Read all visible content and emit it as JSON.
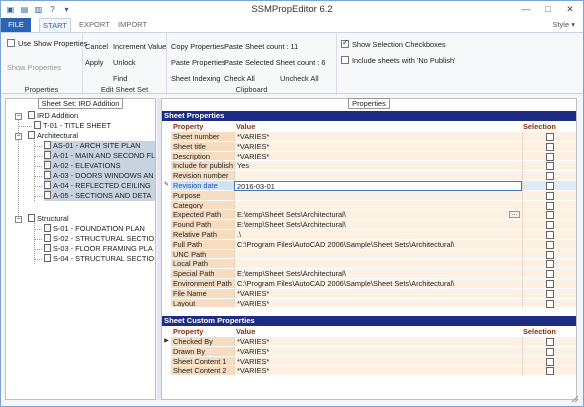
{
  "window": {
    "title": "SSMPropEditor 6.2"
  },
  "quick_access": [
    "save-icon",
    "folder-icon",
    "disk-icon",
    "help-icon",
    "dropdown-icon"
  ],
  "window_controls": {
    "minimize": "—",
    "maximize": "□",
    "close": "✕"
  },
  "tabs": [
    {
      "label": "FILE"
    },
    {
      "label": "START"
    },
    {
      "label": "EXPORT"
    },
    {
      "label": "IMPORT"
    }
  ],
  "style_label": "Style ▾",
  "ribbon": {
    "properties": {
      "use_show_properties": "Use Show Properties",
      "show_properties": "Show Properties",
      "group_label": "Properties"
    },
    "edit_sheet_set": {
      "cancel": "Cancel",
      "increment_value": "Increment Value",
      "apply": "Apply",
      "unlock": "Unlock",
      "find": "Find",
      "group_label": "Edit Sheet Set"
    },
    "clipboard": {
      "copy_properties": "Copy Properties",
      "sheet_count": "Paste Sheet count : 11",
      "paste_properties": "Paste Properties",
      "selected_sheet_count": "Paste Selected Sheet count : 6",
      "sheet_indexing": "Sheet Indexing",
      "check_all": "Check All",
      "uncheck_all": "Uncheck All",
      "group_label": "Clipboard"
    },
    "options": {
      "show_selection_checkboxes": "Show Selection Checkboxes",
      "include_no_publish": "Include sheets with 'No Publish'"
    }
  },
  "left_panel": {
    "title": "Sheet Set: IRD Addition",
    "root": "IRD Addition",
    "nodes": [
      {
        "label": "T-01 - TITLE SHEET"
      },
      {
        "label": "Architectural"
      },
      {
        "label": "AS-01 - ARCH SITE PLAN"
      },
      {
        "label": "A-01 - MAIN AND SECOND FL"
      },
      {
        "label": "A-02 - ELEVATIONS"
      },
      {
        "label": "A-03 - DOORS WINDOWS AN"
      },
      {
        "label": "A-04 - REFLECTED CEILING"
      },
      {
        "label": "A-05 - SECTIONS AND DETA"
      },
      {
        "label": "Structural"
      },
      {
        "label": "S-01 - FOUNDATION PLAN"
      },
      {
        "label": "S-02 - STRUCTURAL SECTIO"
      },
      {
        "label": "S-03 - FLOOR FRAMING PLA"
      },
      {
        "label": "S-04 - STRUCTURAL SECTIO"
      }
    ]
  },
  "right_panel": {
    "title": "Properties",
    "sheet_properties": {
      "header": "Sheet Properties",
      "columns": {
        "property": "Property",
        "value": "Value",
        "selection": "Selection"
      },
      "rows": [
        {
          "property": "Sheet number",
          "value": "*VARIES*"
        },
        {
          "property": "Sheet title",
          "value": "*VARIES*"
        },
        {
          "property": "Description",
          "value": "*VARIES*"
        },
        {
          "property": "Include for publish",
          "value": "Yes"
        },
        {
          "property": "Revision number",
          "value": ""
        },
        {
          "property": "Revision date",
          "value": "2016-03-01"
        },
        {
          "property": "Purpose",
          "value": ""
        },
        {
          "property": "Category",
          "value": ""
        },
        {
          "property": "Expected Path",
          "value": "E:\\temp\\Sheet Sets\\Architectural\\"
        },
        {
          "property": "Found Path",
          "value": "E:\\temp\\Sheet Sets\\Architectural\\"
        },
        {
          "property": "Relative Path",
          "value": ".\\"
        },
        {
          "property": "Full Path",
          "value": "C:\\Program Files\\AutoCAD 2006\\Sample\\Sheet Sets\\Architectural\\"
        },
        {
          "property": "UNC Path",
          "value": ""
        },
        {
          "property": "Local Path",
          "value": ""
        },
        {
          "property": "Special Path",
          "value": "E:\\temp\\Sheet Sets\\Architectural\\"
        },
        {
          "property": "Environment Path",
          "value": "C:\\Program Files\\AutoCAD 2006\\Sample\\Sheet Sets\\Architectural\\"
        },
        {
          "property": "File Name",
          "value": "*VARIES*"
        },
        {
          "property": "Layout",
          "value": "*VARIES*"
        }
      ],
      "browse_label": "..."
    },
    "sheet_custom_properties": {
      "header": "Sheet Custom Properties",
      "columns": {
        "property": "Property",
        "value": "Value",
        "selection": "Selection"
      },
      "rows": [
        {
          "property": "Checked By",
          "value": "*VARIES*"
        },
        {
          "property": "Drawn By",
          "value": "*VARIES*"
        },
        {
          "property": "Sheet Content 1",
          "value": "*VARIES*"
        },
        {
          "property": "Sheet Content 2",
          "value": "*VARIES*"
        }
      ]
    }
  }
}
